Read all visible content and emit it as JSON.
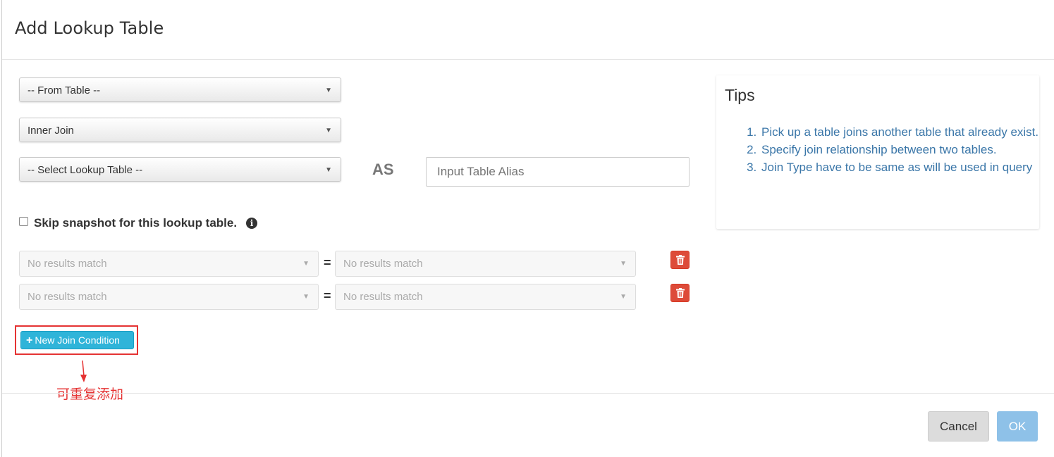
{
  "modal": {
    "title": "Add Lookup Table"
  },
  "form": {
    "from_table": "-- From Table --",
    "join_type": "Inner Join",
    "lookup_table": "-- Select Lookup Table --",
    "as_label": "AS",
    "alias_placeholder": "Input Table Alias",
    "skip_snapshot_label": "Skip snapshot for this lookup table.",
    "skip_snapshot_checked": false
  },
  "join_conditions": [
    {
      "left": "No results match",
      "operator": "=",
      "right": "No results match"
    },
    {
      "left": "No results match",
      "operator": "=",
      "right": "No results match"
    }
  ],
  "new_join_button": "New Join Condition",
  "annotation": "可重复添加",
  "tips": {
    "title": "Tips",
    "items": [
      "Pick up a table joins another table that already exist.",
      "Specify join relationship between two tables.",
      "Join Type have to be same as will be used in query"
    ]
  },
  "footer": {
    "cancel": "Cancel",
    "ok": "OK"
  },
  "colors": {
    "delete_button": "#dd4b39",
    "new_join_button": "#2fb4d9",
    "annotation_red": "#e53333",
    "ok_button": "#8ec1e8",
    "tips_text": "#3a76a8"
  }
}
